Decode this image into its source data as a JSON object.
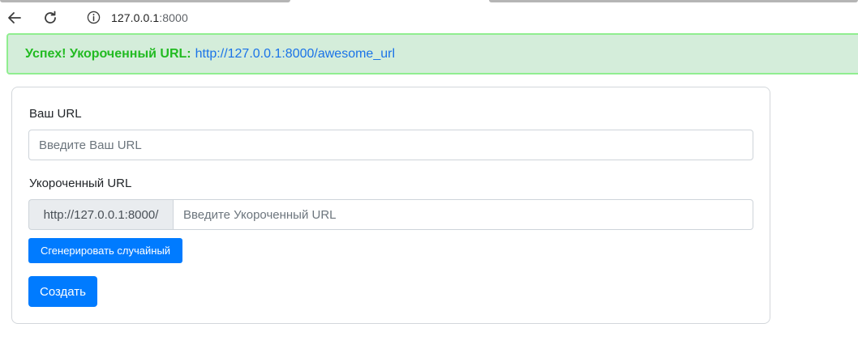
{
  "browser": {
    "url_host": "127.0.0.1",
    "url_port": ":8000"
  },
  "alert": {
    "strong": "Успех! Укороченный URL:",
    "link": "http://127.0.0.1:8000/awesome_url"
  },
  "form": {
    "url_label": "Ваш URL",
    "url_placeholder": "Введите Ваш URL",
    "short_label": "Укороченный URL",
    "short_prefix": "http://127.0.0.1:8000/",
    "short_placeholder": "Введите Укороченный URL",
    "random_button": "Сгенерировать случайный",
    "create_button": "Создать"
  },
  "colors": {
    "alert_bg": "#d4edda",
    "alert_border": "#90ee90",
    "alert_text": "#22bb22",
    "link": "#1a73e8",
    "primary": "#007bff"
  },
  "icons": {
    "back": "arrow-left-icon",
    "reload": "reload-icon",
    "info": "info-icon"
  }
}
